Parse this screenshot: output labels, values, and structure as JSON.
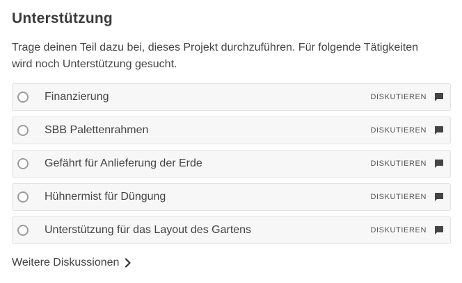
{
  "section": {
    "title": "Unterstützung",
    "description": "Trage deinen Teil dazu bei, dieses Projekt durchzuführen. Für folgende Tätigkeiten wird noch Unterstützung gesucht."
  },
  "tasks": [
    {
      "label": "Finanzierung",
      "action_label": "DISKUTIEREN",
      "icon": "chat-bubble-icon"
    },
    {
      "label": "SBB Palettenrahmen",
      "action_label": "DISKUTIEREN",
      "icon": "chat-bubble-icon"
    },
    {
      "label": "Gefährt für Anlieferung der Erde",
      "action_label": "DISKUTIEREN",
      "icon": "chat-bubble-icon"
    },
    {
      "label": "Hühnermist für Düngung",
      "action_label": "DISKUTIEREN",
      "icon": "chat-bubble-icon"
    },
    {
      "label": "Unterstützung für das Layout des Gartens",
      "action_label": "DISKUTIEREN",
      "icon": "chat-bubble-icon"
    }
  ],
  "footer": {
    "more_link": "Weitere Diskussionen",
    "icon": "chevron-right-icon"
  },
  "colors": {
    "text": "#444444",
    "row_background": "#f7f7f7",
    "row_border": "#e3e3e3",
    "radio_border": "#9c9c9c"
  }
}
